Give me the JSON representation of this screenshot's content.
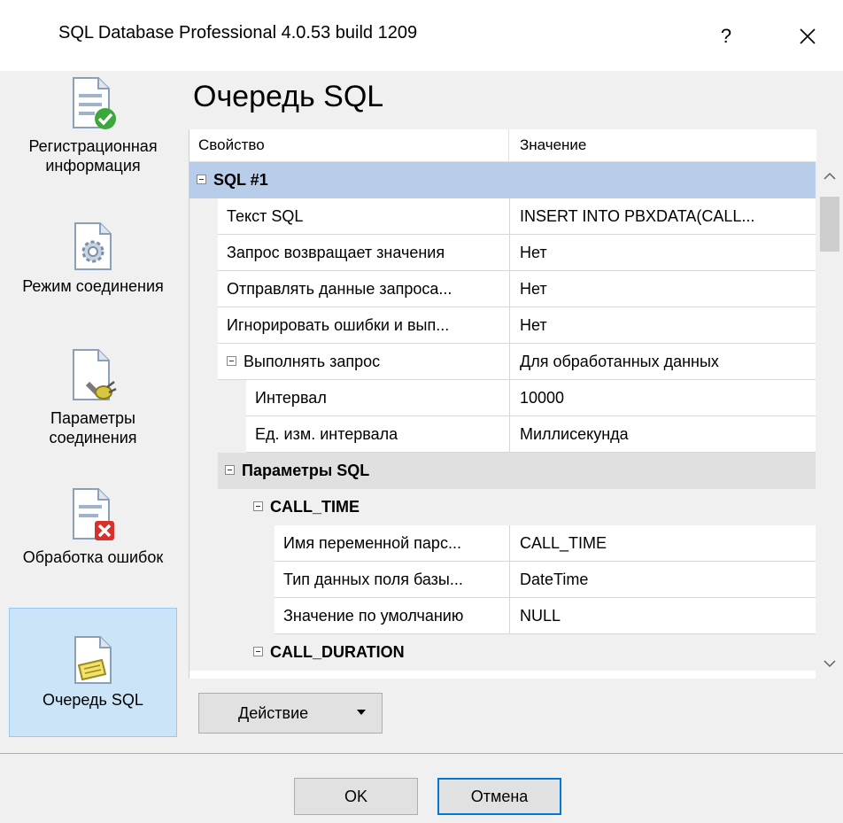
{
  "window": {
    "title": "SQL Database Professional 4.0.53 build 1209",
    "help_label": "?",
    "close_label": "✕"
  },
  "sidebar": {
    "items": [
      {
        "label": "Регистрационная информация",
        "icon": "document-check-icon",
        "active": false
      },
      {
        "label": "Режим соединения",
        "icon": "document-gear-icon",
        "active": false
      },
      {
        "label": "Параметры соединения",
        "icon": "document-plug-icon",
        "active": false
      },
      {
        "label": "Обработка ошибок",
        "icon": "document-error-icon",
        "active": false
      },
      {
        "label": "Очередь SQL",
        "icon": "document-note-icon",
        "active": true
      }
    ]
  },
  "main": {
    "heading": "Очередь SQL"
  },
  "grid": {
    "col_property": "Свойство",
    "col_value": "Значение",
    "rows": [
      {
        "type": "group",
        "level": 0,
        "label": "SQL #1",
        "selected": true
      },
      {
        "type": "prop",
        "level": 1,
        "label": "Текст SQL",
        "value": "INSERT INTO PBXDATA(CALL..."
      },
      {
        "type": "prop",
        "level": 1,
        "label": "Запрос возвращает значения",
        "value": "Нет"
      },
      {
        "type": "prop",
        "level": 1,
        "label": "Отправлять данные запроса...",
        "value": "Нет"
      },
      {
        "type": "prop",
        "level": 1,
        "label": "Игнорировать ошибки и вып...",
        "value": "Нет"
      },
      {
        "type": "expandable",
        "level": 1,
        "label": "Выполнять запрос",
        "value": "Для обработанных данных"
      },
      {
        "type": "prop",
        "level": 2,
        "label": "Интервал",
        "value": "10000"
      },
      {
        "type": "prop",
        "level": 2,
        "label": "Ед. изм. интервала",
        "value": "Миллисекунда"
      },
      {
        "type": "group",
        "level": 1,
        "label": "Параметры SQL",
        "selected": false
      },
      {
        "type": "subgroup",
        "level": 2,
        "label": "CALL_TIME"
      },
      {
        "type": "prop",
        "level": 3,
        "label": "Имя переменной парс...",
        "value": "CALL_TIME"
      },
      {
        "type": "prop",
        "level": 3,
        "label": "Тип данных поля базы...",
        "value": "DateTime"
      },
      {
        "type": "prop",
        "level": 3,
        "label": "Значение по умолчанию",
        "value": "NULL"
      },
      {
        "type": "subgroup",
        "level": 2,
        "label": "CALL_DURATION"
      }
    ]
  },
  "scrollbar": {
    "up": "^",
    "down": "v"
  },
  "actions": {
    "action_label": "Действие"
  },
  "footer": {
    "ok_label": "OK",
    "cancel_label": "Отмена"
  },
  "colors": {
    "selected_group": "#b8cde9",
    "group": "#e0e0e0",
    "active_sidebar": "#cce4f7"
  }
}
